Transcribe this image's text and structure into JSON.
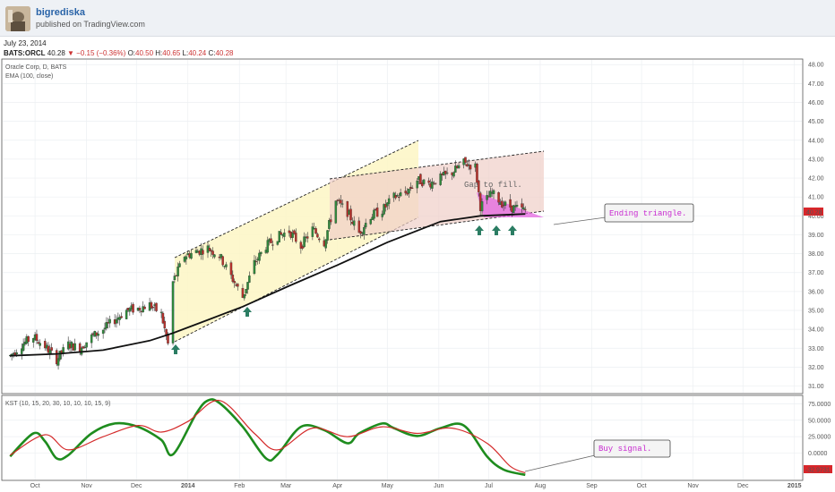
{
  "header": {
    "author": "bigrediska",
    "published": "published on TradingView.com"
  },
  "quote": {
    "date": "July 23, 2014",
    "symbol": "BATS:ORCL",
    "last": "40.28",
    "change": "−0.15 (−0.36%)",
    "o_label": "O:",
    "o": "40.50",
    "h_label": "H:",
    "h": "40.65",
    "l_label": "L:",
    "l": "40.24",
    "c_label": "C:",
    "c": "40.28"
  },
  "chart_data": [
    {
      "type": "candlestick",
      "title": "Oracle Corp, D, BATS",
      "subtitle": "EMA (100, close)",
      "ylim": [
        30.6,
        48.2
      ],
      "y_ticks": [
        "31.00",
        "32.00",
        "33.00",
        "34.00",
        "35.00",
        "36.00",
        "37.00",
        "38.00",
        "39.00",
        "40.00",
        "41.00",
        "42.00",
        "43.00",
        "44.00",
        "45.00",
        "46.00",
        "47.00",
        "48.00"
      ],
      "x_ticks": [
        "Oct",
        "Nov",
        "Dec",
        "2014",
        "Feb",
        "Mar",
        "Apr",
        "May",
        "Jun",
        "Jul",
        "Aug",
        "Sep",
        "Oct",
        "Nov",
        "Dec",
        "2015"
      ],
      "last_price_label": "40.28",
      "price_path": [
        [
          "2013-09-16",
          32.6
        ],
        [
          "2013-09-23",
          33.2
        ],
        [
          "2013-09-30",
          33.6
        ],
        [
          "2013-10-07",
          33.1
        ],
        [
          "2013-10-14",
          32.4
        ],
        [
          "2013-10-21",
          33.2
        ],
        [
          "2013-10-28",
          33.0
        ],
        [
          "2013-11-04",
          33.6
        ],
        [
          "2013-11-11",
          34.0
        ],
        [
          "2013-11-18",
          34.5
        ],
        [
          "2013-11-25",
          35.0
        ],
        [
          "2013-12-02",
          35.1
        ],
        [
          "2013-12-09",
          35.3
        ],
        [
          "2013-12-16",
          34.8
        ],
        [
          "2013-12-20",
          33.2
        ],
        [
          "2013-12-23",
          36.5
        ],
        [
          "2013-12-30",
          37.9
        ],
        [
          "2014-01-06",
          38.1
        ],
        [
          "2014-01-13",
          38.3
        ],
        [
          "2014-01-20",
          37.9
        ],
        [
          "2014-01-27",
          36.8
        ],
        [
          "2014-02-03",
          35.7
        ],
        [
          "2014-02-10",
          37.5
        ],
        [
          "2014-02-17",
          38.4
        ],
        [
          "2014-02-24",
          38.9
        ],
        [
          "2014-03-03",
          39.2
        ],
        [
          "2014-03-10",
          38.4
        ],
        [
          "2014-03-17",
          39.3
        ],
        [
          "2014-03-24",
          38.6
        ],
        [
          "2014-03-31",
          40.8
        ],
        [
          "2014-04-07",
          40.2
        ],
        [
          "2014-04-14",
          39.1
        ],
        [
          "2014-04-21",
          40.0
        ],
        [
          "2014-04-28",
          40.3
        ],
        [
          "2014-05-05",
          41.0
        ],
        [
          "2014-05-12",
          41.2
        ],
        [
          "2014-05-19",
          41.9
        ],
        [
          "2014-05-26",
          41.7
        ],
        [
          "2014-06-02",
          42.0
        ],
        [
          "2014-06-09",
          42.3
        ],
        [
          "2014-06-16",
          42.8
        ],
        [
          "2014-06-23",
          42.6
        ],
        [
          "2014-06-26",
          40.5
        ],
        [
          "2014-07-03",
          41.2
        ],
        [
          "2014-07-10",
          40.6
        ],
        [
          "2014-07-17",
          40.4
        ],
        [
          "2014-07-23",
          40.3
        ]
      ],
      "ema_100": [
        [
          "2013-09-16",
          32.6
        ],
        [
          "2013-10-14",
          32.7
        ],
        [
          "2013-11-11",
          32.9
        ],
        [
          "2013-12-09",
          33.4
        ],
        [
          "2013-12-23",
          33.8
        ],
        [
          "2014-01-13",
          34.5
        ],
        [
          "2014-02-03",
          35.2
        ],
        [
          "2014-03-03",
          36.3
        ],
        [
          "2014-04-01",
          37.4
        ],
        [
          "2014-05-01",
          38.6
        ],
        [
          "2014-06-02",
          39.7
        ],
        [
          "2014-06-26",
          40.0
        ],
        [
          "2014-07-23",
          40.1
        ]
      ],
      "annotations": [
        {
          "text": "Gap to fill."
        },
        {
          "text": "Ending triangle."
        }
      ]
    },
    {
      "type": "line",
      "title": "KST (10, 15, 20, 30, 10, 10, 10, 15, 9)",
      "ylim": [
        -40,
        85
      ],
      "y_ticks": [
        "75.0000",
        "50.0000",
        "25.0000",
        "0.0000"
      ],
      "last_value_label": "-32.9731",
      "series": [
        {
          "name": "",
          "color": "#1e8c1e",
          "values": [
            [
              "2013-09-16",
              -5
            ],
            [
              "2013-09-30",
              30
            ],
            [
              "2013-10-07",
              18
            ],
            [
              "2013-10-14",
              -8
            ],
            [
              "2013-10-21",
              -3
            ],
            [
              "2013-11-04",
              30
            ],
            [
              "2013-11-18",
              45
            ],
            [
              "2013-12-02",
              40
            ],
            [
              "2013-12-16",
              20
            ],
            [
              "2013-12-23",
              -2
            ],
            [
              "2014-01-06",
              60
            ],
            [
              "2014-01-13",
              80
            ],
            [
              "2014-01-20",
              76
            ],
            [
              "2014-02-03",
              40
            ],
            [
              "2014-02-17",
              -8
            ],
            [
              "2014-02-24",
              -2
            ],
            [
              "2014-03-10",
              40
            ],
            [
              "2014-03-24",
              35
            ],
            [
              "2014-04-07",
              15
            ],
            [
              "2014-04-14",
              30
            ],
            [
              "2014-04-28",
              45
            ],
            [
              "2014-05-05",
              38
            ],
            [
              "2014-05-19",
              26
            ],
            [
              "2014-06-02",
              38
            ],
            [
              "2014-06-16",
              42
            ],
            [
              "2014-06-30",
              -5
            ],
            [
              "2014-07-10",
              -25
            ],
            [
              "2014-07-23",
              -33
            ]
          ]
        },
        {
          "name": "",
          "color": "#d42a2a",
          "values": [
            [
              "2013-09-16",
              -3
            ],
            [
              "2013-10-07",
              28
            ],
            [
              "2013-10-21",
              5
            ],
            [
              "2013-11-11",
              25
            ],
            [
              "2013-12-02",
              42
            ],
            [
              "2013-12-16",
              32
            ],
            [
              "2014-01-01",
              48
            ],
            [
              "2014-01-20",
              80
            ],
            [
              "2014-02-10",
              30
            ],
            [
              "2014-02-24",
              5
            ],
            [
              "2014-03-17",
              38
            ],
            [
              "2014-04-07",
              25
            ],
            [
              "2014-04-28",
              40
            ],
            [
              "2014-05-19",
              30
            ],
            [
              "2014-06-09",
              38
            ],
            [
              "2014-06-30",
              15
            ],
            [
              "2014-07-14",
              -20
            ],
            [
              "2014-07-23",
              -30
            ]
          ]
        }
      ],
      "annotations": [
        {
          "text": "Buy signal."
        }
      ]
    }
  ]
}
